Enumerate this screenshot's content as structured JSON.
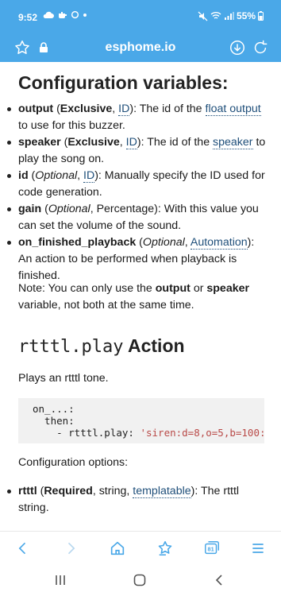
{
  "status_bar": {
    "time": "9:52",
    "battery": "55%"
  },
  "browser": {
    "domain": "esphome.io"
  },
  "content": {
    "config_heading": "Configuration variables:",
    "variables": [
      {
        "name": "output",
        "p1": " (",
        "req": "Exclusive",
        "p2": ", ",
        "type_link": "ID",
        "p3": "): The id of the ",
        "link2": "float output",
        "p4": " to use for this buzzer."
      },
      {
        "name": "speaker",
        "p1": " (",
        "req": "Exclusive",
        "p2": ", ",
        "type_link": "ID",
        "p3": "): The id of the ",
        "link2": "speaker",
        "p4": " to play the song on."
      },
      {
        "name": "id",
        "p1": " (",
        "req": "Optional",
        "p2": ", ",
        "type_link": "ID",
        "p3": "): Manually specify the ID used for code generation."
      },
      {
        "name": "gain",
        "p1": " (",
        "req": "Optional",
        "p2": ", Percentage): With this value you can set the volume of the sound."
      },
      {
        "name": "on_finished_playback",
        "p1": " (",
        "req": "Optional",
        "p2": ", ",
        "type_link": "Automation",
        "p3": "): An action to be performed when playback is finished."
      }
    ],
    "note": {
      "before": "Note: You can only use the ",
      "b1": "output",
      "mid": " or ",
      "b2": "speaker",
      "after": " variable, not both at the same time."
    },
    "action_heading": {
      "code": "rtttl.play",
      "word": " Action"
    },
    "plays_text": "Plays an rtttl tone.",
    "code": {
      "line1": "on_...:",
      "line2": "  then:",
      "line3_prefix": "    - rtttl.play: ",
      "line3_string": "'siren:d=8,o=5,b=100:d"
    },
    "config_options": "Configuration options:",
    "options": [
      {
        "name": "rtttl",
        "p1": " (",
        "req": "Required",
        "p2": ", string, ",
        "link": "templatable",
        "p3": "): The rtttl string."
      }
    ]
  },
  "toolbar": {
    "back": "back-icon",
    "forward": "forward-icon",
    "home": "home-icon",
    "bookmarks": "bookmark-star-icon",
    "tabs_count": "81",
    "menu": "menu-icon"
  },
  "colors": {
    "accent": "#4aa8e8",
    "link": "#1f4f7a",
    "code_bg": "#f1f1f1",
    "code_string": "#b94a48"
  }
}
